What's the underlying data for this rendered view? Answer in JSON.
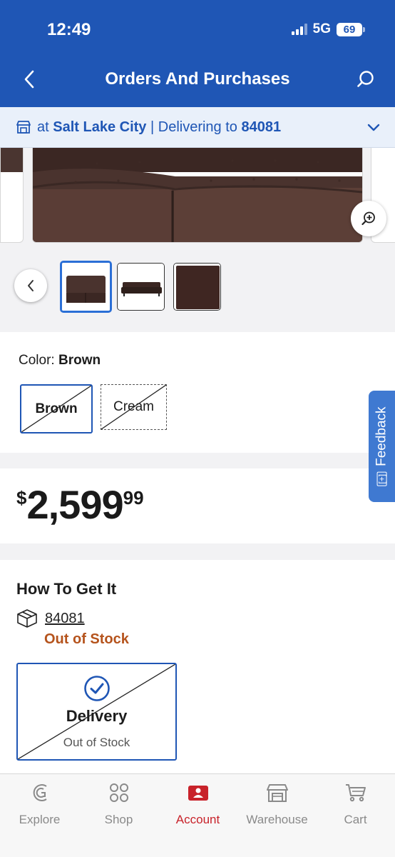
{
  "status_bar": {
    "time": "12:49",
    "network": "5G",
    "battery": "69"
  },
  "header": {
    "title": "Orders And Purchases"
  },
  "location": {
    "prefix": "at",
    "store": "Salt Lake City",
    "separator": "|",
    "delivering_label": "Delivering to",
    "zip": "84081"
  },
  "product": {
    "color_label": "Color:",
    "color_value": "Brown",
    "colors": [
      {
        "name": "Brown",
        "selected": true,
        "available": false
      },
      {
        "name": "Cream",
        "selected": false,
        "available": false
      }
    ],
    "price": {
      "currency": "$",
      "dollars": "2,599",
      "cents": "99"
    }
  },
  "fulfillment": {
    "title": "How To Get It",
    "zip": "84081",
    "status": "Out of Stock",
    "delivery": {
      "label": "Delivery",
      "status": "Out of Stock"
    }
  },
  "feedback": {
    "icon_text": "[+]",
    "label": "Feedback"
  },
  "tabs": [
    {
      "label": "Explore",
      "icon": "explore-icon",
      "active": false
    },
    {
      "label": "Shop",
      "icon": "shop-grid-icon",
      "active": false
    },
    {
      "label": "Account",
      "icon": "account-icon",
      "active": true
    },
    {
      "label": "Warehouse",
      "icon": "warehouse-icon",
      "active": false
    },
    {
      "label": "Cart",
      "icon": "cart-icon",
      "active": false
    }
  ],
  "colors": {
    "brand_blue": "#1f56b5",
    "accent_red": "#c8222a",
    "stock_orange": "#b5531c"
  }
}
